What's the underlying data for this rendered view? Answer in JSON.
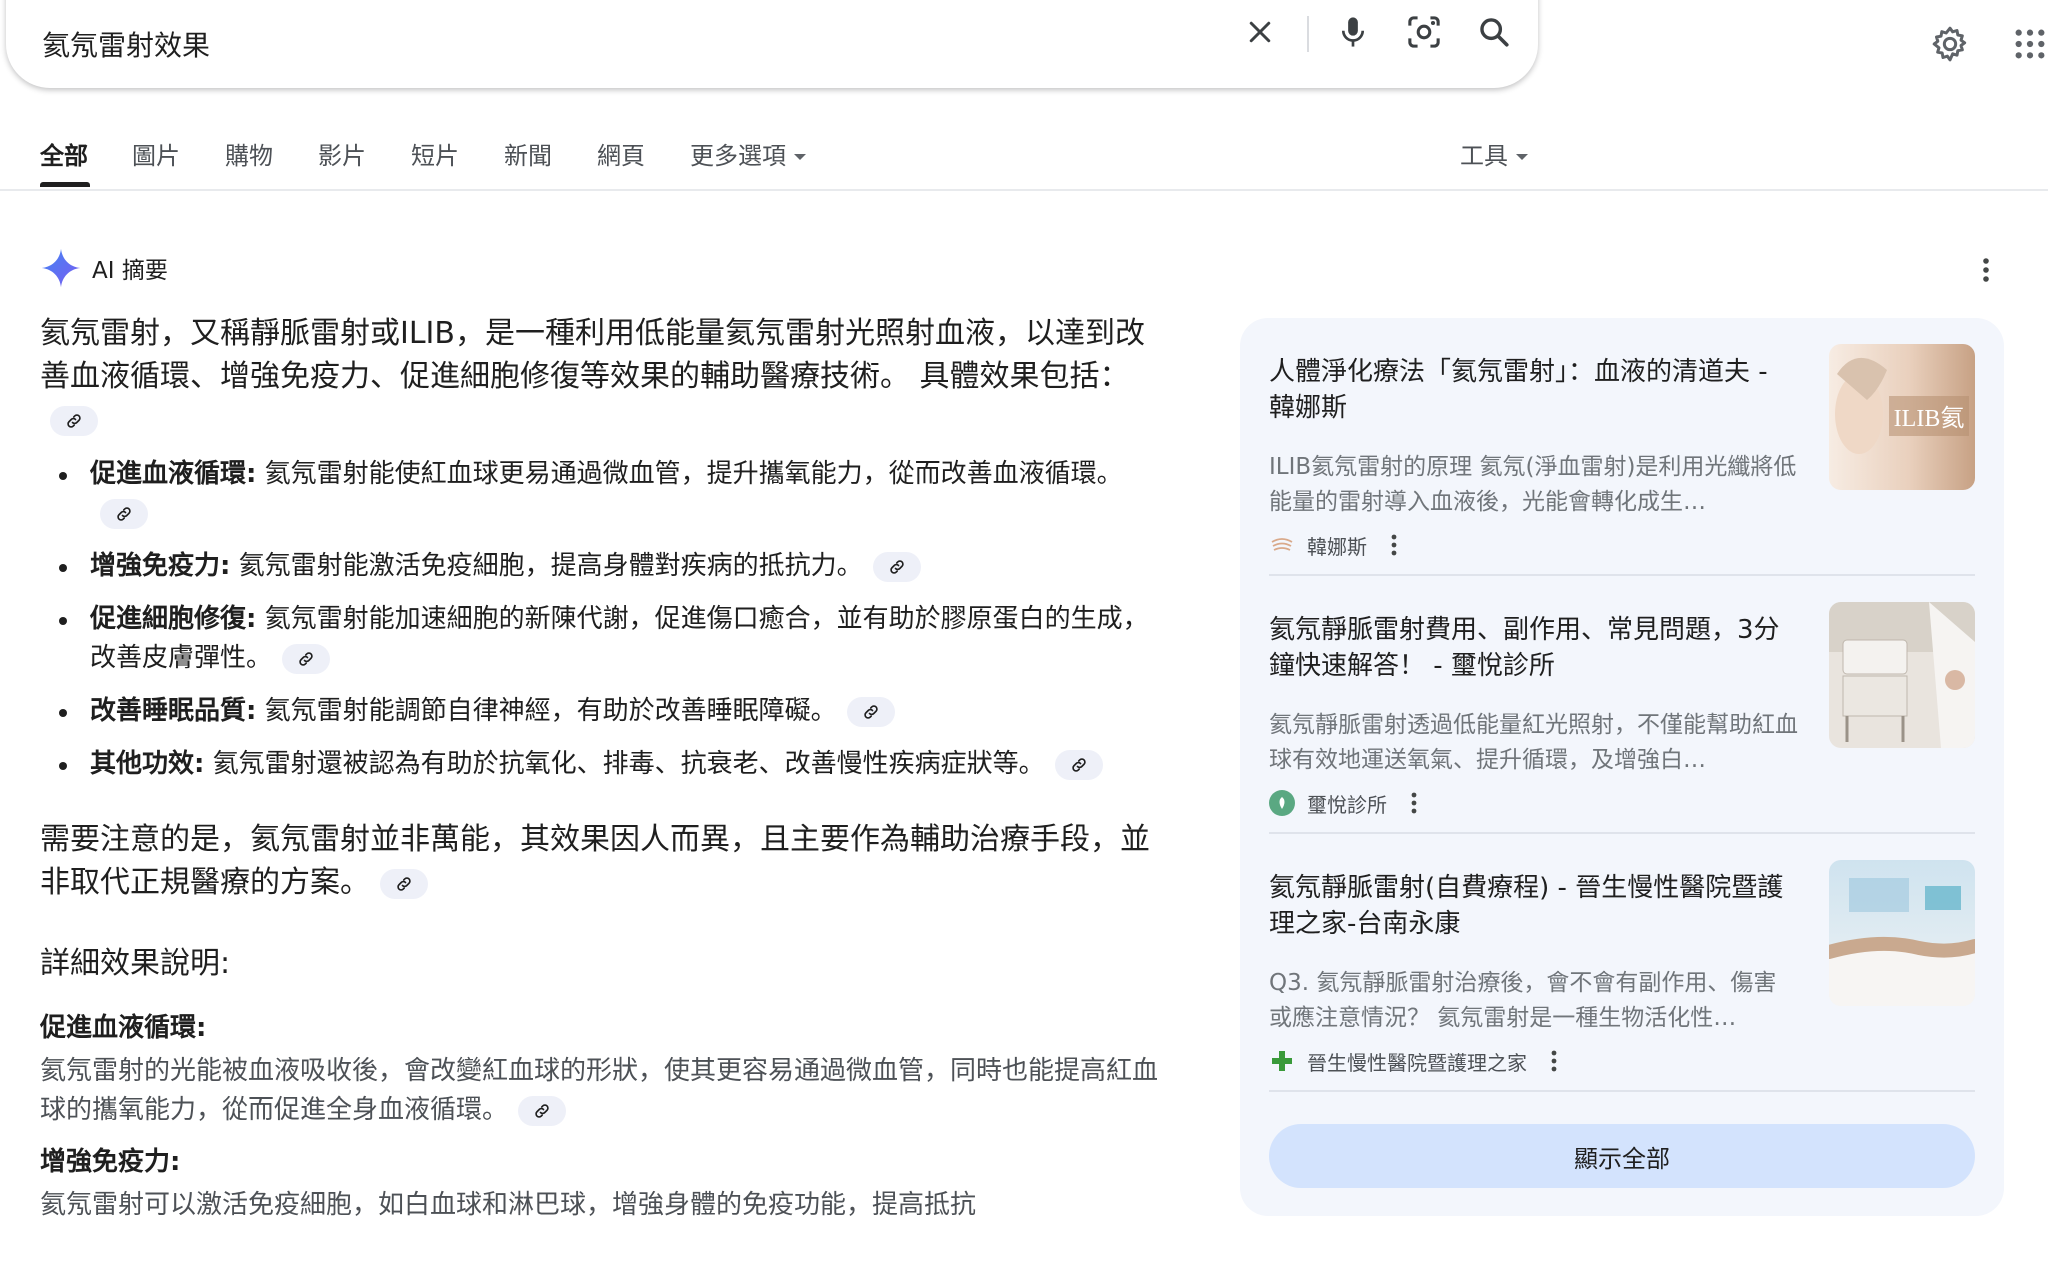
{
  "search": {
    "query": "氦氖雷射效果",
    "icons": [
      "close-icon",
      "mic-icon",
      "lens-icon",
      "search-icon"
    ]
  },
  "top_icons": [
    "settings-gear-icon",
    "apps-grid-icon"
  ],
  "tabs": [
    {
      "label": "全部",
      "active": true
    },
    {
      "label": "圖片"
    },
    {
      "label": "購物"
    },
    {
      "label": "影片"
    },
    {
      "label": "短片"
    },
    {
      "label": "新聞"
    },
    {
      "label": "網頁"
    },
    {
      "label": "更多選項"
    }
  ],
  "tools_label": "工具",
  "ai": {
    "title": "AI 摘要",
    "lead": "氦氖雷射，又稱靜脈雷射或ILIB，是一種利用低能量氦氖雷射光照射血液，以達到改善血液循環、增強免疫力、促進細胞修復等效果的輔助醫療技術。 具體效果包括：",
    "bullets": [
      {
        "term": "促進血液循環:",
        "text": " 氦氖雷射能使紅血球更易通過微血管，提升攜氧能力，從而改善血液循環。"
      },
      {
        "term": "增強免疫力:",
        "text": " 氦氖雷射能激活免疫細胞，提高身體對疾病的抵抗力。"
      },
      {
        "term": "促進細胞修復:",
        "text": " 氦氖雷射能加速細胞的新陳代謝，促進傷口癒合，並有助於膠原蛋白的生成，改善皮膚彈性。"
      },
      {
        "term": "改善睡眠品質:",
        "text": " 氦氖雷射能調節自律神經，有助於改善睡眠障礙。"
      },
      {
        "term": "其他功效:",
        "text": " 氦氖雷射還被認為有助於抗氧化、排毒、抗衰老、改善慢性疾病症狀等。"
      }
    ],
    "note": "需要注意的是，氦氖雷射並非萬能，其效果因人而異，且主要作為輔助治療手段，並非取代正規醫療的方案。",
    "detail_heading": "詳細效果說明:",
    "details": [
      {
        "heading": "促進血液循環:",
        "text": "氦氖雷射的光能被血液吸收後，會改變紅血球的形狀，使其更容易通過微血管，同時也能提高紅血球的攜氧能力，從而促進全身血液循環。"
      },
      {
        "heading": "增強免疫力:",
        "text": "氦氖雷射可以激活免疫細胞，如白血球和淋巴球，增強身體的免疫功能，提高抵抗"
      }
    ]
  },
  "sources": [
    {
      "title": "人體淨化療法「氦氖雷射」：血液的清道夫 - 韓娜斯",
      "snippet": "ILIB氦氖雷射的原理 氦氖(淨血雷射)是利用光纖將低能量的雷射導入血液後，光能會轉化成生…",
      "site": "韓娜斯",
      "thumb_text": "ILIB氦",
      "color": "#d9a98a"
    },
    {
      "title": "氦氖靜脈雷射費用、副作用、常見問題，3分鐘快速解答！ - 璽悅診所",
      "snippet": "氦氖靜脈雷射透過低能量紅光照射，不僅能幫助紅血球有效地運送氧氣、提升循環，及增強白…",
      "site": "璽悅診所",
      "color": "#5aa882"
    },
    {
      "title": "氦氖靜脈雷射(自費療程) - 晉生慢性醫院暨護理之家-台南永康",
      "snippet": "Q3. 氦氖靜脈雷射治療後，會不會有副作用、傷害或應注意情況？ 氦氖雷射是一種生物活化性…",
      "site": "晉生慢性醫院暨護理之家",
      "color": "#3a9a3a"
    }
  ],
  "show_all_label": "顯示全部"
}
